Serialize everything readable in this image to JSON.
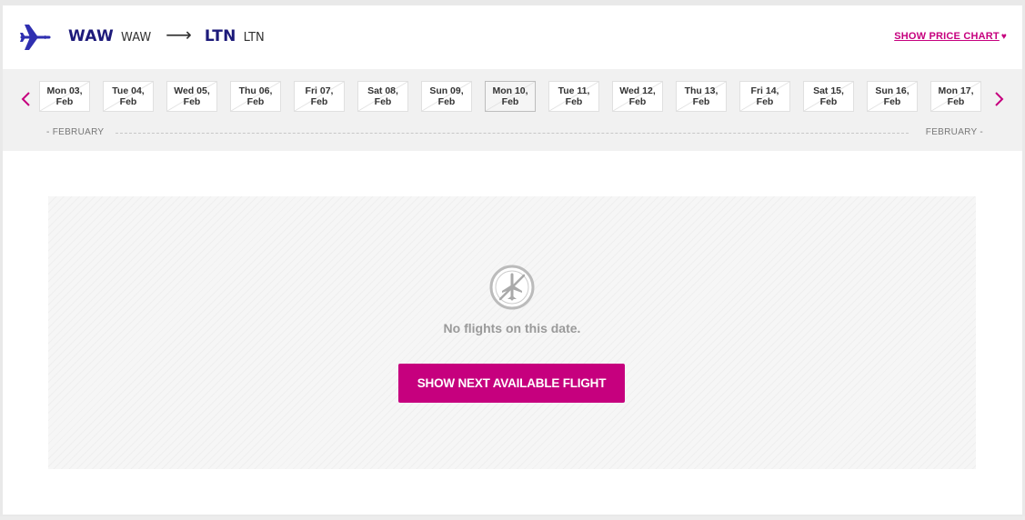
{
  "header": {
    "origin_code": "WAW",
    "origin_sub": "WAW",
    "arrow": "⟶",
    "destination_code": "LTN",
    "destination_sub": "LTN",
    "price_chart_label": "SHOW PRICE CHART",
    "plane_icon": "plane-icon",
    "heart_icon": "heart-icon"
  },
  "date_selector": {
    "prev_icon": "chevron-left-icon",
    "next_icon": "chevron-right-icon",
    "selected_index": 7,
    "days": [
      {
        "day": "Mon 03,",
        "month": "Feb"
      },
      {
        "day": "Tue 04,",
        "month": "Feb"
      },
      {
        "day": "Wed 05,",
        "month": "Feb"
      },
      {
        "day": "Thu 06,",
        "month": "Feb"
      },
      {
        "day": "Fri 07,",
        "month": "Feb"
      },
      {
        "day": "Sat 08,",
        "month": "Feb"
      },
      {
        "day": "Sun 09,",
        "month": "Feb"
      },
      {
        "day": "Mon 10,",
        "month": "Feb"
      },
      {
        "day": "Tue 11,",
        "month": "Feb"
      },
      {
        "day": "Wed 12,",
        "month": "Feb"
      },
      {
        "day": "Thu 13,",
        "month": "Feb"
      },
      {
        "day": "Fri 14,",
        "month": "Feb"
      },
      {
        "day": "Sat 15,",
        "month": "Feb"
      },
      {
        "day": "Sun 16,",
        "month": "Feb"
      },
      {
        "day": "Mon 17,",
        "month": "Feb"
      }
    ],
    "month_left": "- FEBRUARY",
    "month_right": "FEBRUARY -"
  },
  "results": {
    "empty_icon": "no-flights-icon",
    "message": "No flights on this date.",
    "cta_label": "SHOW NEXT AVAILABLE FLIGHT"
  },
  "colors": {
    "brand_magenta": "#c6007e",
    "brand_navy": "#1d1a7a",
    "plane_blue": "#2f2fb0"
  }
}
